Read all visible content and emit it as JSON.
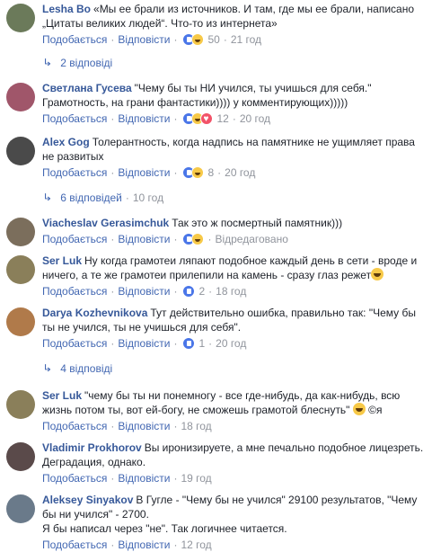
{
  "labels": {
    "like": "Подобається",
    "reply": "Відповісти",
    "dot": "·",
    "edited": "Відредаговано"
  },
  "comments": [
    {
      "author": "Lesha Bo",
      "text": "«Мы ее брали из источников. И там, где мы ее брали, написано „Цитаты великих людей“. Что-то из интернета»",
      "reactions": [
        "like",
        "haha"
      ],
      "count": "50",
      "time": "21 год",
      "avatar_color": "#6b7a5a"
    },
    {
      "author": "Светлана Гусева",
      "text": "\"Чему бы ты НИ учился, ты учишься для себя.\" Грамотность, на грани фантастики)))) у комментирующих)))))",
      "reactions": [
        "like",
        "haha",
        "love"
      ],
      "count": "12",
      "time": "20 год",
      "avatar_color": "#a0566a"
    },
    {
      "author": "Alex Gog",
      "text": "Толерантность, когда надпись на памятнике не ущимляет права не развитых",
      "reactions": [
        "like",
        "haha"
      ],
      "count": "8",
      "time": "20 год",
      "avatar_color": "#4a4a4a"
    },
    {
      "author": "Viacheslav Gerasimchuk",
      "text": "Так это ж посмертный памятник)))",
      "reactions": [
        "like",
        "haha"
      ],
      "count": "",
      "time": "",
      "avatar_color": "#7b6e5c"
    },
    {
      "author": "Ser Luk",
      "text": "Ну когда грамотеи ляпают подобное каждый день в сети - вроде и ничего, а те же грамотеи прилепили на камень - сразу глаз режет",
      "reactions": [
        "like"
      ],
      "count": "2",
      "time": "18 год",
      "avatar_color": "#8a7f5a"
    },
    {
      "author": "Darya Kozhevnikova",
      "text": "Тут действительно ошибка, правильно так: \"Чему бы ты не учился, ты не учишься для себя\".",
      "reactions": [
        "like"
      ],
      "count": "1",
      "time": "20 год",
      "avatar_color": "#b07a4a"
    },
    {
      "author": "Ser Luk",
      "text": "\"чему бы ты ни понемногу - все где-нибудь, да как-нибудь, всю жизнь потом ты, вот ей-богу, не сможешь грамотой блеснуть\"",
      "suffix": "©я",
      "reactions": [],
      "count": "",
      "time": "18 год",
      "avatar_color": "#8a7f5a"
    },
    {
      "author": "Vladimir Prokhorov",
      "text": "Вы иронизируете, а мне печально подобное лицезреть. Деградация, однако.",
      "reactions": [],
      "count": "",
      "time": "19 год",
      "avatar_color": "#5a4a4a"
    },
    {
      "author": "Aleksey Sinyakov",
      "text": "В Гугле - \"Чему бы не учился\" 29100 результатов, \"Чему бы ни учился\" - 2700.",
      "text2": "Я бы написал через \"не\". Так логичнее читается.",
      "reactions": [],
      "count": "",
      "time": "12 год",
      "avatar_color": "#6a7a8a"
    }
  ],
  "reply_links": [
    {
      "label": "2 відповіді",
      "time": ""
    },
    {
      "label": "6 відповідей",
      "time": "10 год"
    },
    {
      "label": "4 відповіді",
      "time": ""
    }
  ]
}
